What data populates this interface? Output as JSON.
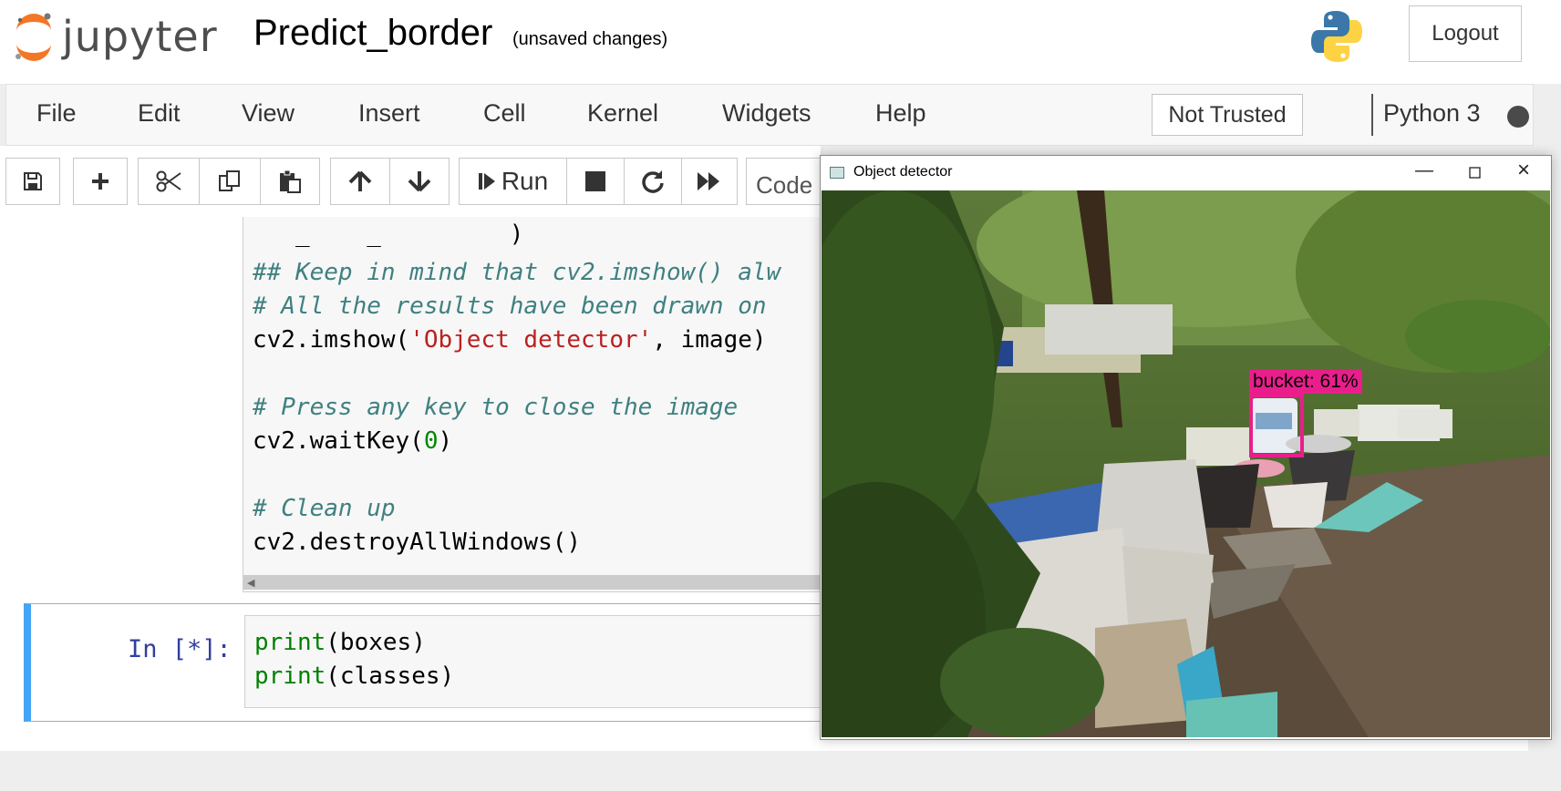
{
  "header": {
    "logo_text": "jupyter",
    "notebook_title": "Predict_border",
    "save_status": "(unsaved changes)",
    "logout_label": "Logout"
  },
  "menu": {
    "items": [
      "File",
      "Edit",
      "View",
      "Insert",
      "Cell",
      "Kernel",
      "Widgets",
      "Help"
    ],
    "trust_label": "Not Trusted",
    "kernel_name": "Python 3"
  },
  "toolbar": {
    "run_label": "Run",
    "cell_type": "Code"
  },
  "cells": {
    "cell1": {
      "lines": [
        "## Keep in mind that cv2.imshow() alw",
        "# All the results have been drawn on",
        "cv2.imshow(",
        "'Object detector'",
        ", image)",
        "# Press any key to close the image",
        "cv2.waitKey(",
        "0",
        ")",
        "# Clean up",
        "cv2.destroyAllWindows()"
      ]
    },
    "cell2": {
      "prompt": "In [*]:",
      "lines": [
        "print",
        "(boxes)",
        "print",
        "(classes)"
      ]
    }
  },
  "detector_window": {
    "title": "Object detector",
    "detection_label": "bucket: 61%"
  },
  "colors": {
    "accent_blue": "#42a5f5",
    "detection_box": "#e91e8c"
  }
}
